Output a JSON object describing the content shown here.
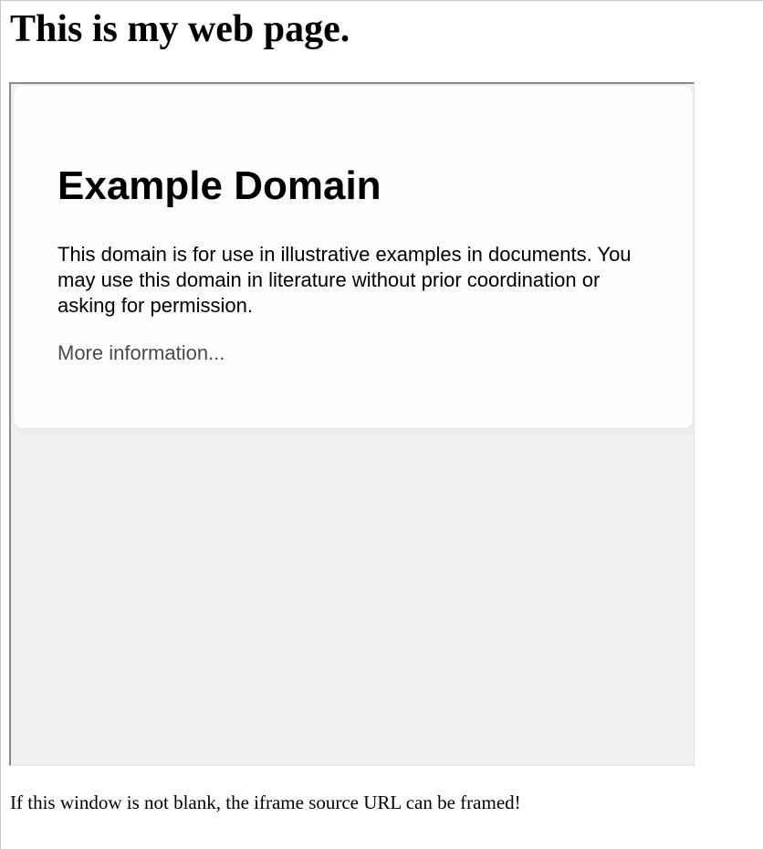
{
  "page": {
    "heading": "This is my web page.",
    "footer_note": "If this window is not blank, the iframe source URL can be framed!"
  },
  "iframe": {
    "title": "Example Domain",
    "description": "This domain is for use in illustrative examples in documents. You may use this domain in literature without prior coordination or asking for permission.",
    "link_label": "More information...",
    "colors": {
      "background": "#f0f0f2",
      "card": "#fdfdff",
      "link": "#4a4a4a"
    }
  }
}
